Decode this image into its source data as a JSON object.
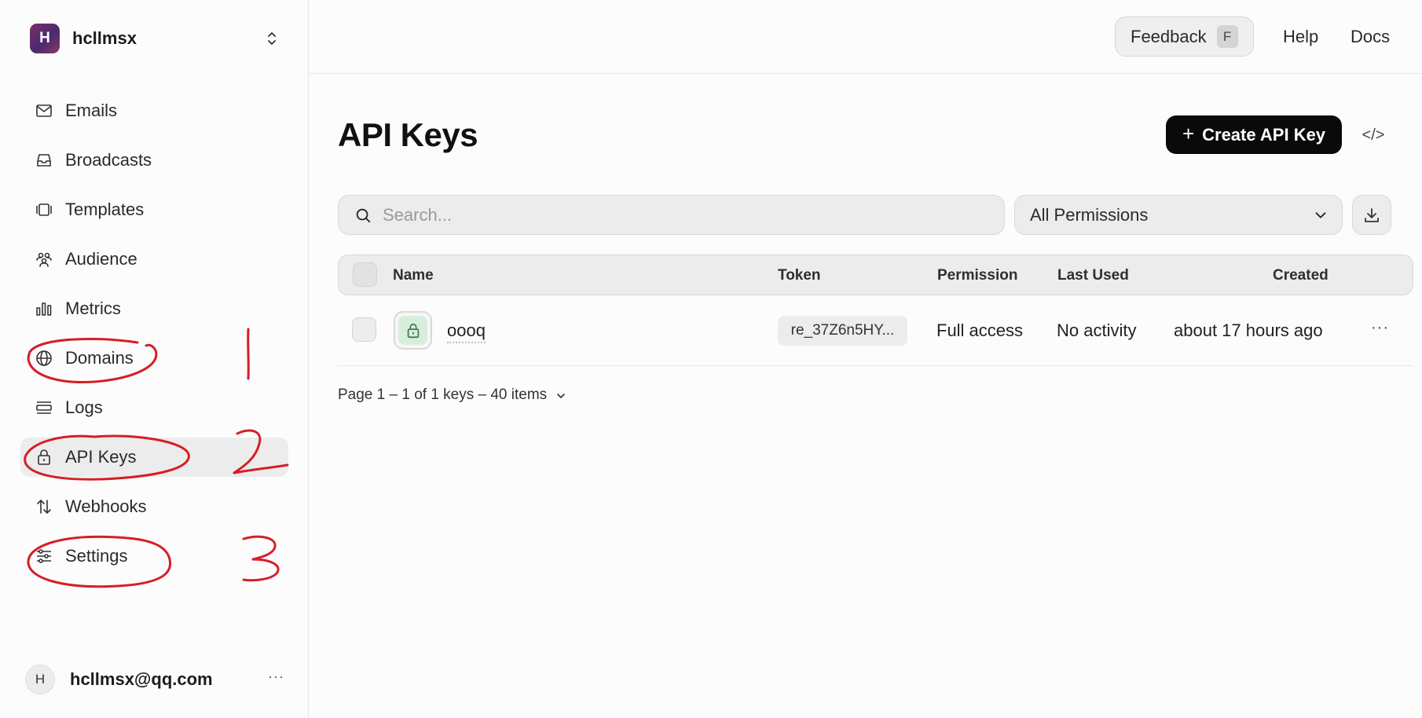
{
  "workspace": {
    "initial": "H",
    "name": "hcllmsx"
  },
  "nav": [
    {
      "label": "Emails",
      "icon": "mail-icon"
    },
    {
      "label": "Broadcasts",
      "icon": "inbox-icon"
    },
    {
      "label": "Templates",
      "icon": "templates-icon"
    },
    {
      "label": "Audience",
      "icon": "users-icon"
    },
    {
      "label": "Metrics",
      "icon": "bar-chart-icon"
    },
    {
      "label": "Domains",
      "icon": "globe-icon"
    },
    {
      "label": "Logs",
      "icon": "logs-icon"
    },
    {
      "label": "API Keys",
      "icon": "lock-icon",
      "active": true
    },
    {
      "label": "Webhooks",
      "icon": "arrows-icon"
    },
    {
      "label": "Settings",
      "icon": "sliders-icon"
    }
  ],
  "user": {
    "initial": "H",
    "email": "hcllmsx@qq.com",
    "more": "···"
  },
  "header": {
    "feedback_label": "Feedback",
    "feedback_key": "F",
    "help": "Help",
    "docs": "Docs"
  },
  "page": {
    "title": "API Keys",
    "create_label": "Create API Key",
    "code_label": "</>"
  },
  "search": {
    "placeholder": "Search...",
    "value": ""
  },
  "filter": {
    "permissions": "All Permissions"
  },
  "table": {
    "headers": {
      "name": "Name",
      "token": "Token",
      "permission": "Permission",
      "last_used": "Last Used",
      "created": "Created"
    },
    "rows": [
      {
        "name": "oooq",
        "token": "re_37Z6n5HY...",
        "permission": "Full access",
        "last_used": "No activity",
        "created": "about 17 hours ago",
        "more": "···"
      }
    ]
  },
  "pagination": {
    "label": "Page 1 – 1 of 1 keys – 40 items"
  },
  "annotations": {
    "color": "#d41f26",
    "step1": "1",
    "step2": "2",
    "step3": "3"
  },
  "colors": {
    "accent": "#0a0a0a",
    "key_icon_bg": "#d8eedc",
    "key_icon_fg": "#2f7a4a"
  }
}
